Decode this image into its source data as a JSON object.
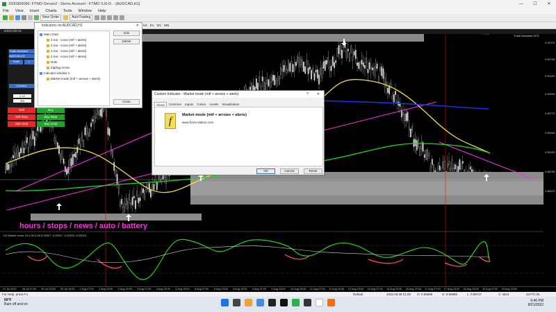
{
  "window": {
    "title": "1500306080: FTMO-Server2 - Demo Account - FTMO S.R.O. - [AUDCAD,H1]",
    "min": "—",
    "max": "☐",
    "close": "✕"
  },
  "menu": [
    "File",
    "View",
    "Insert",
    "Charts",
    "Tools",
    "Window",
    "Help"
  ],
  "toolbar": {
    "new_order": "New Order",
    "autotrading": "AutoTrading",
    "timeframes": [
      "M1",
      "M5",
      "M15",
      "M30",
      "H1",
      "H4",
      "D1",
      "W1",
      "MN"
    ]
  },
  "chart": {
    "tab": "AUDCAD,H1",
    "trade_assistant_label": "Trade Assistant MT4",
    "subwindow_label": "H1 Market mode 20.0,50.0,80 0.00007 -0.00017 -0.00024 -0.00024",
    "overlay_text": "hours / stops / news / auto / battery",
    "price_labels": [
      "0.91070",
      "0.90745",
      "0.90420",
      "0.90095",
      "0.89770",
      "0.89445",
      "0.89120",
      "0.88795",
      "0.88470"
    ],
    "time_labels": [
      "27 Jul 2022",
      "28 Jul 07:00",
      "28 Jul 23:00",
      "29 Jul 15:00",
      "1 Aug 07:00",
      "1 Aug 23:00",
      "2 Aug 15:00",
      "3 Aug 07:00",
      "3 Aug 23:00",
      "4 Aug 15:00",
      "5 Aug 07:00",
      "5 Aug 23:00",
      "8 Aug 15:00",
      "9 Aug 07:00",
      "9 Aug 23:00",
      "10 Aug 15:00",
      "11 Aug 07:00",
      "11 Aug 23:00",
      "12 Aug 15:00",
      "15 Aug 07:00",
      "15 Aug 23:00",
      "16 Aug 15:00",
      "17 Aug 07:00",
      "17 Aug 23:00",
      "18 Aug 15:00",
      "19 Aug 07:00",
      "19 Aug 23:00"
    ]
  },
  "trade_panel": {
    "title": "Trade Assistant",
    "symbol": "AUDCAD.H1",
    "trade": "Trade",
    "l": "L",
    "connect": "Connect",
    "lot": "0.10",
    "points": "300",
    "sell": "Sell",
    "buy": "Buy",
    "sell_stop": "Sell Stop",
    "buy_stop": "Buy Stop",
    "sell_limit": "Sell Limit",
    "buy_limit": "Buy Limit"
  },
  "indicators_panel": {
    "title": "Indicators on AUDCAD,H1",
    "items": [
      "Main chart",
      "3 ma - cross (mtf + alerts)",
      "3 ma - cross (mtf + alerts)",
      "3 ma - cross (mtf + alerts)",
      "3 ma - cross (mtf + alerts)",
      "Note",
      "ZigZag Arrow",
      "Indicator window 1",
      "Market mode (mtf + arrows + alerts)"
    ],
    "edit": "Edit",
    "delete": "Delete",
    "close": "Close"
  },
  "dialog": {
    "title": "Custom Indicator - Market mode (mtf + arrows + alerts)",
    "help": "?",
    "close": "✕",
    "tabs": [
      "About",
      "Common",
      "Inputs",
      "Colors",
      "Levels",
      "Visualization"
    ],
    "logo": "f",
    "name": "Market mode (mtf + arrows + alerts)",
    "site": "www.forex-station.com",
    "ok": "OK",
    "cancel": "Cancel",
    "reset": "Reset"
  },
  "statusbar": {
    "help": "For Help, press F1",
    "profile": "Default",
    "datetime": "2022.08.08 21:00",
    "o": "O: 0.89698",
    "h": "H: 0.89888",
    "l": "L: 0.89727",
    "v": "V: 4624",
    "bars": "3477/1 kb"
  },
  "taskbar": {
    "temp": "69°F",
    "weather": "Rain off and on",
    "time": "6:40 PM",
    "date": "8/21/2022"
  },
  "colors": {
    "yellow_ma": "#f0e040",
    "green_ma": "#18e018",
    "blue_ma": "#1c34ff",
    "magenta": "#ff2de6",
    "panel_gray": "#8a8a8a",
    "candle": "#e8e8e8",
    "sell_red": "#e8292b",
    "buy_green": "#22a32a"
  }
}
